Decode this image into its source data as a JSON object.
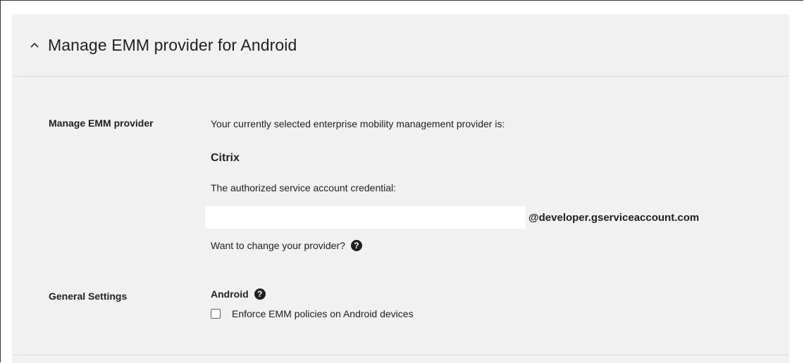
{
  "section": {
    "title": "Manage EMM provider for Android",
    "collapse_icon": "chevron-up-icon"
  },
  "emm": {
    "label": "Manage EMM provider",
    "intro_text": "Your currently selected enterprise mobility management provider is:",
    "provider_name": "Citrix",
    "credential_text": "The authorized service account credential:",
    "credential_suffix": "@developer.gserviceaccount.com",
    "change_text": "Want to change your provider?",
    "help_icon": "help-circle-icon"
  },
  "general": {
    "label": "General Settings",
    "platform": "Android",
    "help_icon": "help-circle-icon",
    "checkbox_label": "Enforce EMM policies on Android devices",
    "checkbox_checked": false
  },
  "colors": {
    "card_bg": "#f1f1f1",
    "text": "#212121",
    "divider": "#dedede"
  }
}
